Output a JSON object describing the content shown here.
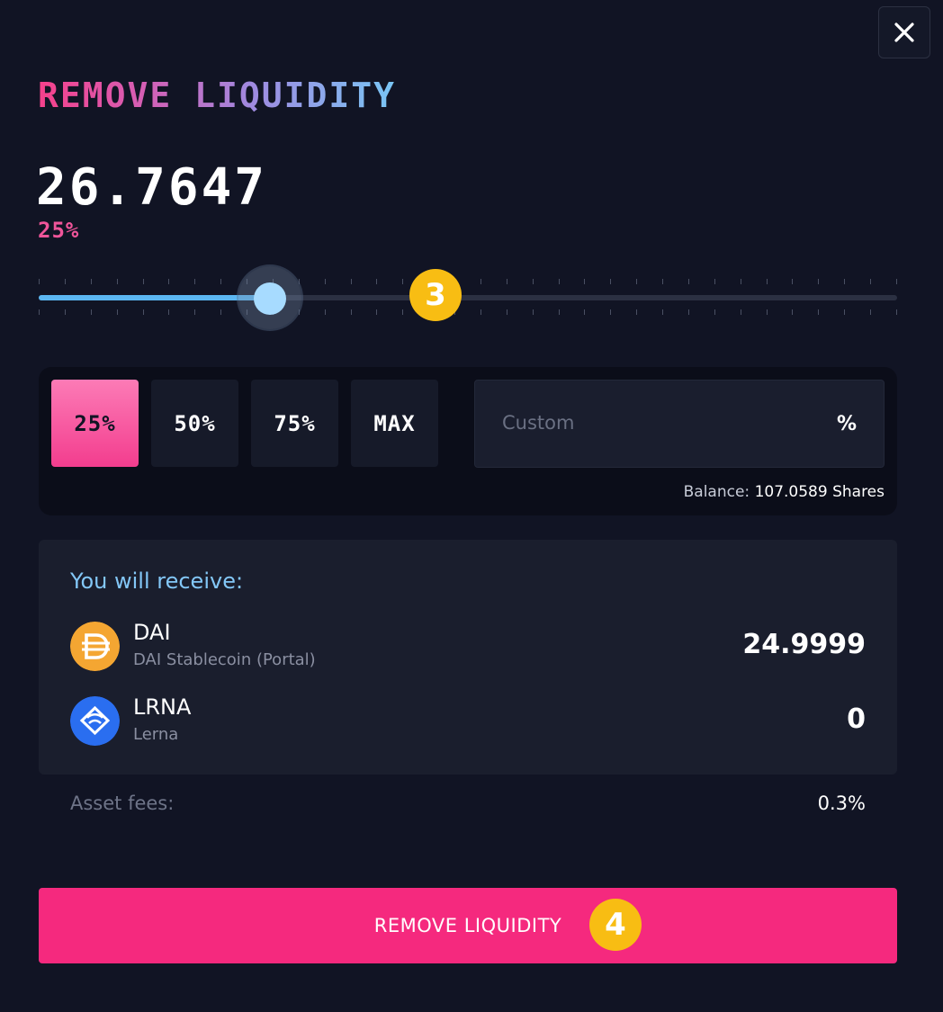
{
  "modal": {
    "title": "REMOVE LIQUIDITY",
    "close_icon": "close-icon"
  },
  "amount": {
    "value": "26.7647",
    "percent_label": "25%"
  },
  "slider": {
    "percent": 25,
    "step_badge": "3"
  },
  "presets": {
    "options": [
      "25%",
      "50%",
      "75%",
      "MAX"
    ],
    "selected": "25%"
  },
  "custom": {
    "placeholder": "Custom",
    "value": "",
    "suffix": "%"
  },
  "balance": {
    "label": "Balance:",
    "value": "107.0589 Shares"
  },
  "receive": {
    "label": "You will receive:",
    "assets": [
      {
        "symbol": "DAI",
        "name": "DAI Stablecoin (Portal)",
        "amount": "24.9999",
        "icon": "dai-icon"
      },
      {
        "symbol": "LRNA",
        "name": "Lerna",
        "amount": "0",
        "icon": "lerna-icon"
      }
    ]
  },
  "fees": {
    "label": "Asset fees:",
    "value": "0.3%"
  },
  "submit": {
    "label": "REMOVE LIQUIDITY",
    "step_badge": "4"
  },
  "colors": {
    "background": "#111424",
    "accent_pink": "#f5297e",
    "accent_blue": "#5cb7f2",
    "badge_yellow": "#f8bd13"
  }
}
